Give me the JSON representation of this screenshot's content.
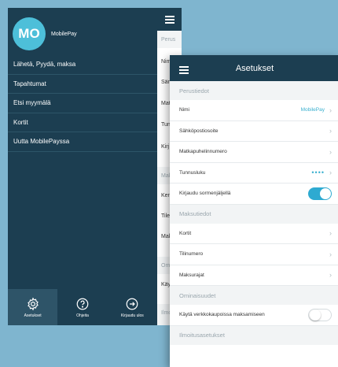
{
  "drawer": {
    "avatar_initials": "MO",
    "app_name": "MobilePay",
    "items": [
      {
        "label": "Lähetä, Pyydä, maksa"
      },
      {
        "label": "Tapahtumat"
      },
      {
        "label": "Etsi myymälä"
      },
      {
        "label": "Kortit"
      },
      {
        "label": "Uutta MobilePayssa"
      }
    ],
    "bottom": [
      {
        "label": "Asetukset",
        "icon": "gear-icon",
        "active": true
      },
      {
        "label": "Ohjeita",
        "icon": "help-icon",
        "active": false
      },
      {
        "label": "Kirjaudu ulos",
        "icon": "logout-icon",
        "active": false
      }
    ],
    "peek": [
      "Perus",
      "Nim",
      "Sär",
      "Mat",
      "Tun",
      "Kirj",
      "Mak",
      "Ker",
      "Tile",
      "Mak",
      "Omi",
      "Käy",
      "Ilmo"
    ]
  },
  "settings": {
    "title": "Asetukset",
    "sections": {
      "basic": "Perustiedot",
      "payment": "Maksutiedot",
      "personal": "Ominaisuudet",
      "notifications": "Ilmoitusasetukset"
    },
    "rows": {
      "name_label": "Nimi",
      "name_value": "MobilePay",
      "email_label": "Sähköpostiosoite",
      "phone_label": "Matkapuhelinnumero",
      "passcode_label": "Tunnusluku",
      "passcode_value": "••••",
      "fingerprint_label": "Kirjaudu sormenjäljellä",
      "cards_label": "Kortit",
      "accounts_label": "Tilinumero",
      "limits_label": "Maksurajat",
      "online_label": "Käytä verkkokaupoissa maksamiseen"
    },
    "toggles": {
      "fingerprint": true,
      "online": false
    }
  },
  "colors": {
    "navy": "#1c3e51",
    "accent": "#2eaad1",
    "avatar": "#4dbfd9",
    "background": "#7fb5cf"
  }
}
